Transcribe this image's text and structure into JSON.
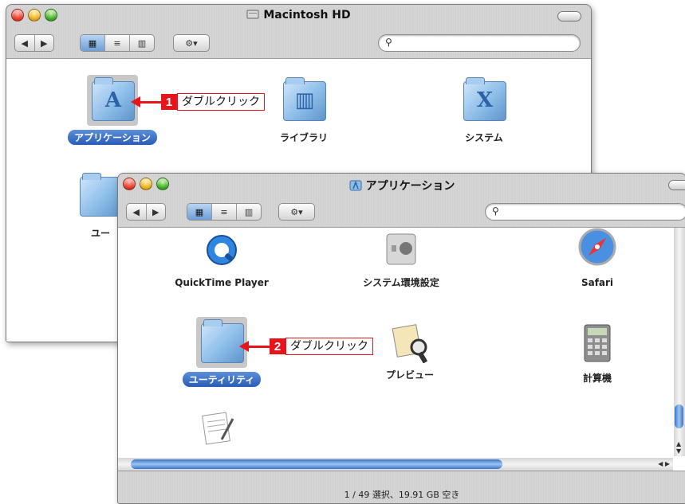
{
  "back_window": {
    "title": "Macintosh HD",
    "items": [
      {
        "label": "アプリケーション",
        "icon": "applications-folder-icon",
        "selected": true
      },
      {
        "label": "ライブラリ",
        "icon": "library-folder-icon",
        "selected": false
      },
      {
        "label": "システム",
        "icon": "system-folder-icon",
        "selected": false
      },
      {
        "label": "ユー",
        "icon": "users-folder-icon",
        "selected": false
      }
    ]
  },
  "front_window": {
    "title": "アプリケーション",
    "items": [
      {
        "label": "QuickTime Player",
        "icon": "quicktime-icon"
      },
      {
        "label": "システム環境設定",
        "icon": "system-preferences-icon"
      },
      {
        "label": "Safari",
        "icon": "safari-icon"
      },
      {
        "label": "ユーティリティ",
        "icon": "utilities-folder-icon",
        "selected": true
      },
      {
        "label": "プレビュー",
        "icon": "preview-icon"
      },
      {
        "label": "計算機",
        "icon": "calculator-icon"
      },
      {
        "label": "",
        "icon": "textedit-icon"
      }
    ],
    "status": "1 / 49 選択、19.91 GB 空き"
  },
  "callouts": [
    {
      "number": "1",
      "text": "ダブルクリック"
    },
    {
      "number": "2",
      "text": "ダブルクリック"
    }
  ],
  "colors": {
    "callout": "#e8141b",
    "selection": "#2a5db5"
  }
}
